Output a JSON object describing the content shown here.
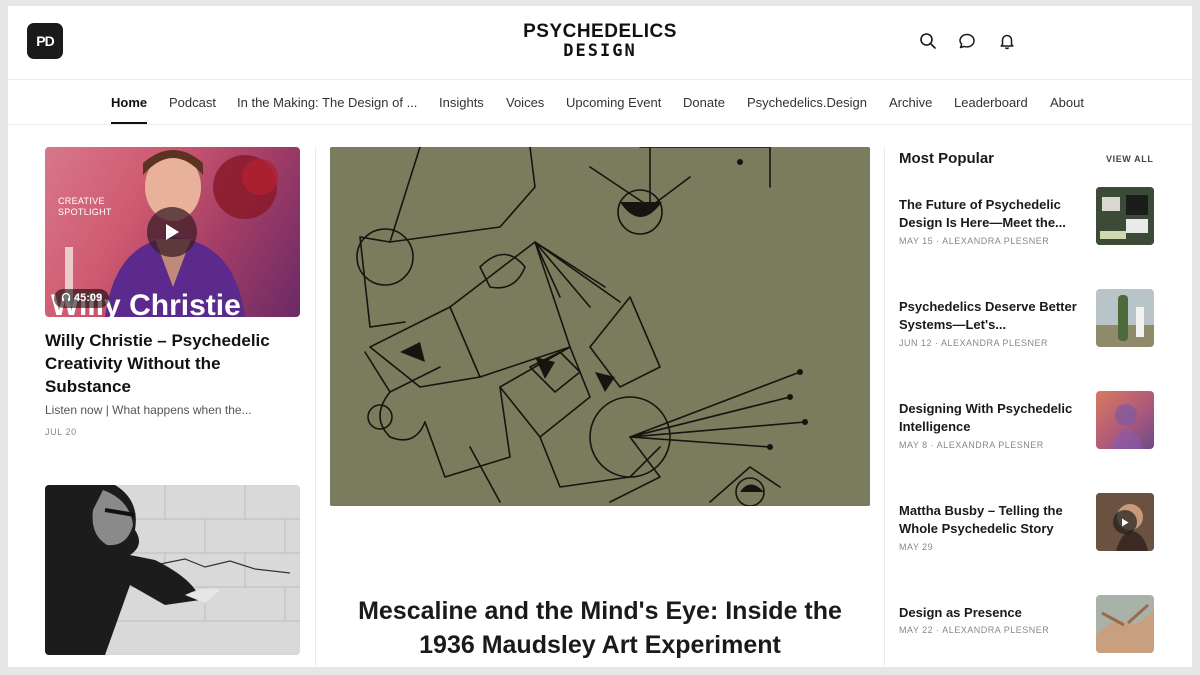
{
  "header": {
    "logo_badge": "PD",
    "brand_line1": "PSYCHEDELICS",
    "brand_line2": "DESIGN",
    "icons": [
      "search-icon",
      "chat-icon",
      "bell-icon"
    ]
  },
  "nav": {
    "items": [
      {
        "label": "Home",
        "active": true
      },
      {
        "label": "Podcast"
      },
      {
        "label": "In the Making: The Design of ..."
      },
      {
        "label": "Insights"
      },
      {
        "label": "Voices"
      },
      {
        "label": "Upcoming Event"
      },
      {
        "label": "Donate"
      },
      {
        "label": "Psychedelics.Design"
      },
      {
        "label": "Archive"
      },
      {
        "label": "Leaderboard"
      },
      {
        "label": "About"
      }
    ]
  },
  "left": {
    "card1": {
      "spotlight": "CREATIVE\nSPOTLIGHT",
      "duration": "45:09",
      "title": "Willy Christie – Psychedelic Creativity Without the Substance",
      "subtitle": "Listen now | What happens when the...",
      "date": "JUL 20"
    }
  },
  "center": {
    "hero_title": "Mescaline and the Mind's Eye: Inside the 1936 Maudsley Art Experiment"
  },
  "most_popular": {
    "title": "Most Popular",
    "view_all": "VIEW ALL",
    "items": [
      {
        "title": "The Future of Psychedelic Design Is Here—Meet the...",
        "meta": "MAY 15 · ALEXANDRA PLESNER"
      },
      {
        "title": "Psychedelics Deserve Better Systems—Let's...",
        "meta": "JUN 12 · ALEXANDRA PLESNER"
      },
      {
        "title": "Designing With Psychedelic Intelligence",
        "meta": "MAY 8 · ALEXANDRA PLESNER"
      },
      {
        "title": "Mattha Busby – Telling the Whole Psychedelic Story",
        "meta": "MAY 29"
      },
      {
        "title": "Design as Presence",
        "meta": "MAY 22 · ALEXANDRA PLESNER"
      }
    ]
  },
  "colors": {
    "accent": "#111111",
    "hero_bg": "#797b5c",
    "meta_text": "#888888"
  }
}
